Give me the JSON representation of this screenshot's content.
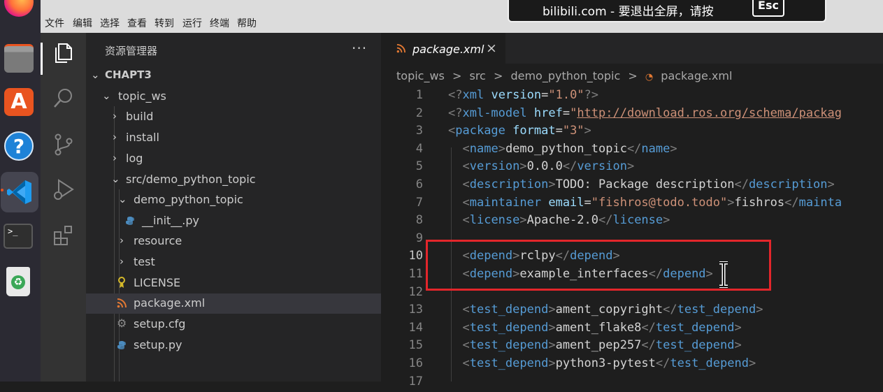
{
  "colors": {
    "accent": "#e95420",
    "highlight": "#e3262b",
    "tag": "#569cd6",
    "attr": "#9cdcfe",
    "string": "#ce9178"
  },
  "dock": {
    "items": [
      {
        "icon": "firefox-icon"
      },
      {
        "icon": "files-icon"
      },
      {
        "icon": "software-icon",
        "glyph": "A"
      },
      {
        "icon": "help-icon",
        "glyph": "?"
      },
      {
        "icon": "vscode-icon"
      },
      {
        "icon": "terminal-icon",
        "glyph": ">_"
      },
      {
        "icon": "trash-icon",
        "glyph": "♻"
      }
    ]
  },
  "notification": {
    "text": "bilibili.com - 要退出全屏，请按",
    "key": "Esc"
  },
  "menubar": [
    "文件",
    "编辑",
    "选择",
    "查看",
    "转到",
    "运行",
    "终端",
    "帮助"
  ],
  "activitybar": [
    "explorer-icon",
    "search-icon",
    "source-control-icon",
    "run-debug-icon",
    "extensions-icon"
  ],
  "sidebar": {
    "title": "资源管理器",
    "more": "···",
    "tree": [
      {
        "label": "CHAPT3",
        "chevron": "v",
        "bold": true
      },
      {
        "label": "topic_ws",
        "chevron": "v"
      },
      {
        "label": "build",
        "chevron": ">"
      },
      {
        "label": "install",
        "chevron": ">"
      },
      {
        "label": "log",
        "chevron": ">"
      },
      {
        "label": "src/demo_python_topic",
        "chevron": "v"
      },
      {
        "label": "demo_python_topic",
        "chevron": "v"
      },
      {
        "label": "__init__.py",
        "icon": "python-file-icon"
      },
      {
        "label": "resource",
        "chevron": ">"
      },
      {
        "label": "test",
        "chevron": ">"
      },
      {
        "label": "LICENSE",
        "icon": "license-file-icon"
      },
      {
        "label": "package.xml",
        "icon": "xml-file-icon",
        "selected": true
      },
      {
        "label": "setup.cfg",
        "icon": "gear-file-icon"
      },
      {
        "label": "setup.py",
        "icon": "python-file-icon"
      }
    ]
  },
  "editor": {
    "tab": {
      "label": "package.xml",
      "close": "×"
    },
    "breadcrumb": [
      "topic_ws",
      ">",
      "src",
      ">",
      "demo_python_topic",
      ">",
      "package.xml"
    ],
    "current_line": 10,
    "lines": [
      {
        "n": "1",
        "tokens": [
          [
            "br",
            "<?"
          ],
          [
            "tag",
            "xml"
          ],
          [
            "txt",
            " "
          ],
          [
            "attr",
            "version"
          ],
          [
            "txt",
            "="
          ],
          [
            "str",
            "\"1.0\""
          ],
          [
            "br",
            "?>"
          ]
        ]
      },
      {
        "n": "2",
        "tokens": [
          [
            "br",
            "<?"
          ],
          [
            "tag",
            "xml-model"
          ],
          [
            "txt",
            " "
          ],
          [
            "attr",
            "href"
          ],
          [
            "txt",
            "="
          ],
          [
            "str",
            "\""
          ],
          [
            "url",
            "http://download.ros.org/schema/packag"
          ]
        ]
      },
      {
        "n": "3",
        "tokens": [
          [
            "br",
            "<"
          ],
          [
            "tag",
            "package"
          ],
          [
            "txt",
            " "
          ],
          [
            "attr",
            "format"
          ],
          [
            "txt",
            "="
          ],
          [
            "str",
            "\"3\""
          ],
          [
            "br",
            ">"
          ]
        ]
      },
      {
        "n": "4",
        "tokens": [
          [
            "txt",
            "  "
          ],
          [
            "br",
            "<"
          ],
          [
            "tag",
            "name"
          ],
          [
            "br",
            ">"
          ],
          [
            "txt",
            "demo_python_topic"
          ],
          [
            "br",
            "</"
          ],
          [
            "tag",
            "name"
          ],
          [
            "br",
            ">"
          ]
        ]
      },
      {
        "n": "5",
        "tokens": [
          [
            "txt",
            "  "
          ],
          [
            "br",
            "<"
          ],
          [
            "tag",
            "version"
          ],
          [
            "br",
            ">"
          ],
          [
            "txt",
            "0.0.0"
          ],
          [
            "br",
            "</"
          ],
          [
            "tag",
            "version"
          ],
          [
            "br",
            ">"
          ]
        ]
      },
      {
        "n": "6",
        "tokens": [
          [
            "txt",
            "  "
          ],
          [
            "br",
            "<"
          ],
          [
            "tag",
            "description"
          ],
          [
            "br",
            ">"
          ],
          [
            "txt",
            "TODO: Package description"
          ],
          [
            "br",
            "</"
          ],
          [
            "tag",
            "description"
          ],
          [
            "br",
            ">"
          ]
        ]
      },
      {
        "n": "7",
        "tokens": [
          [
            "txt",
            "  "
          ],
          [
            "br",
            "<"
          ],
          [
            "tag",
            "maintainer"
          ],
          [
            "txt",
            " "
          ],
          [
            "attr",
            "email"
          ],
          [
            "txt",
            "="
          ],
          [
            "str",
            "\"fishros@todo.todo\""
          ],
          [
            "br",
            ">"
          ],
          [
            "txt",
            "fishros"
          ],
          [
            "br",
            "</"
          ],
          [
            "tag",
            "mainta"
          ]
        ]
      },
      {
        "n": "8",
        "tokens": [
          [
            "txt",
            "  "
          ],
          [
            "br",
            "<"
          ],
          [
            "tag",
            "license"
          ],
          [
            "br",
            ">"
          ],
          [
            "txt",
            "Apache-2.0"
          ],
          [
            "br",
            "</"
          ],
          [
            "tag",
            "license"
          ],
          [
            "br",
            ">"
          ]
        ]
      },
      {
        "n": "9",
        "tokens": []
      },
      {
        "n": "10",
        "tokens": [
          [
            "txt",
            "  "
          ],
          [
            "br",
            "<"
          ],
          [
            "tag",
            "depend"
          ],
          [
            "br",
            ">"
          ],
          [
            "txt",
            "rclpy"
          ],
          [
            "br",
            "</"
          ],
          [
            "tag",
            "depend"
          ],
          [
            "br",
            ">"
          ]
        ]
      },
      {
        "n": "11",
        "tokens": [
          [
            "txt",
            "  "
          ],
          [
            "br",
            "<"
          ],
          [
            "tag",
            "depend"
          ],
          [
            "br",
            ">"
          ],
          [
            "txt",
            "example_interfaces"
          ],
          [
            "br",
            "</"
          ],
          [
            "tag",
            "depend"
          ],
          [
            "br",
            ">"
          ]
        ]
      },
      {
        "n": "12",
        "tokens": []
      },
      {
        "n": "13",
        "tokens": [
          [
            "txt",
            "  "
          ],
          [
            "br",
            "<"
          ],
          [
            "tag",
            "test_depend"
          ],
          [
            "br",
            ">"
          ],
          [
            "txt",
            "ament_copyright"
          ],
          [
            "br",
            "</"
          ],
          [
            "tag",
            "test_depend"
          ],
          [
            "br",
            ">"
          ]
        ]
      },
      {
        "n": "14",
        "tokens": [
          [
            "txt",
            "  "
          ],
          [
            "br",
            "<"
          ],
          [
            "tag",
            "test_depend"
          ],
          [
            "br",
            ">"
          ],
          [
            "txt",
            "ament_flake8"
          ],
          [
            "br",
            "</"
          ],
          [
            "tag",
            "test_depend"
          ],
          [
            "br",
            ">"
          ]
        ]
      },
      {
        "n": "15",
        "tokens": [
          [
            "txt",
            "  "
          ],
          [
            "br",
            "<"
          ],
          [
            "tag",
            "test_depend"
          ],
          [
            "br",
            ">"
          ],
          [
            "txt",
            "ament_pep257"
          ],
          [
            "br",
            "</"
          ],
          [
            "tag",
            "test_depend"
          ],
          [
            "br",
            ">"
          ]
        ]
      },
      {
        "n": "16",
        "tokens": [
          [
            "txt",
            "  "
          ],
          [
            "br",
            "<"
          ],
          [
            "tag",
            "test_depend"
          ],
          [
            "br",
            ">"
          ],
          [
            "txt",
            "python3-pytest"
          ],
          [
            "br",
            "</"
          ],
          [
            "tag",
            "test_depend"
          ],
          [
            "br",
            ">"
          ]
        ]
      },
      {
        "n": "17",
        "tokens": []
      }
    ]
  }
}
